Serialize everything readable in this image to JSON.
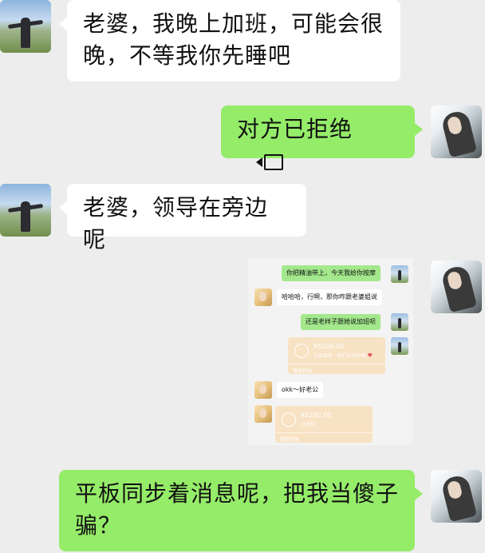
{
  "messages": [
    {
      "side": "left",
      "text": "老婆，我晚上加班，可能会很晚，不等我你先睡吧"
    },
    {
      "side": "right",
      "text": "对方已拒绝",
      "icon": "video-call-icon"
    },
    {
      "side": "left",
      "text": "老婆，领导在旁边呢"
    },
    {
      "side": "right",
      "type": "image"
    },
    {
      "side": "right",
      "text": "平板同步着消息呢，把我当傻子骗？"
    }
  ],
  "embedded": {
    "m1": "你把精油带上，今天我给你按摩",
    "m2": "哈哈哈，行啊，那你咋跟老婆姐说",
    "m3": "还是老样子跟她说加班呗",
    "transfer1_amount": "¥5200.00",
    "transfer1_sub": "已被接收 · 你们关系好啊",
    "transfer1_foot": "微信转账",
    "heart": "♥",
    "m4": "okk～好老公",
    "transfer2_amount": "¥5200.00",
    "transfer2_sub": "已收款",
    "transfer2_foot": "微信转账"
  },
  "colors": {
    "background": "#ededed",
    "right_bubble": "#95ec69",
    "left_bubble": "#ffffff",
    "transfer": "#f8e2c4"
  }
}
